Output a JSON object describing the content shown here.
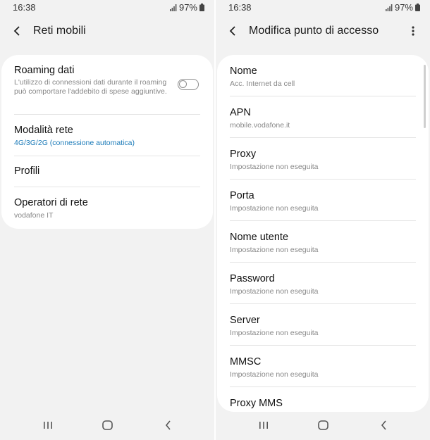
{
  "status_bar": {
    "time": "16:38",
    "battery": "97%"
  },
  "left_screen": {
    "title": "Reti mobili",
    "items": [
      {
        "label": "Roaming dati",
        "sublabel": "L'utilizzo di connessioni dati durante il roaming può comportare l'addebito di spese aggiuntive.",
        "toggle_on": false
      },
      {
        "label": "Modalità rete",
        "sublabel": "4G/3G/2G (connessione automatica)"
      },
      {
        "label": "Profili"
      },
      {
        "label": "Operatori di rete",
        "sublabel": "vodafone IT"
      }
    ]
  },
  "right_screen": {
    "title": "Modifica punto di accesso",
    "items": [
      {
        "label": "Nome",
        "value": "Acc. Internet da cell"
      },
      {
        "label": "APN",
        "value": "mobile.vodafone.it"
      },
      {
        "label": "Proxy",
        "value": "Impostazione non eseguita"
      },
      {
        "label": "Porta",
        "value": "Impostazione non eseguita"
      },
      {
        "label": "Nome utente",
        "value": "Impostazione non eseguita"
      },
      {
        "label": "Password",
        "value": "Impostazione non eseguita"
      },
      {
        "label": "Server",
        "value": "Impostazione non eseguita"
      },
      {
        "label": "MMSC",
        "value": "Impostazione non eseguita"
      },
      {
        "label": "Proxy MMS"
      }
    ]
  },
  "colors": {
    "background": "#f2f2f2",
    "card": "#ffffff",
    "accent": "#1a7ab8",
    "secondary_text": "#888888"
  },
  "icons": [
    "signal-icon",
    "battery-icon",
    "back-arrow-icon",
    "more-options-icon",
    "recent-apps-icon",
    "home-icon",
    "nav-back-icon"
  ]
}
